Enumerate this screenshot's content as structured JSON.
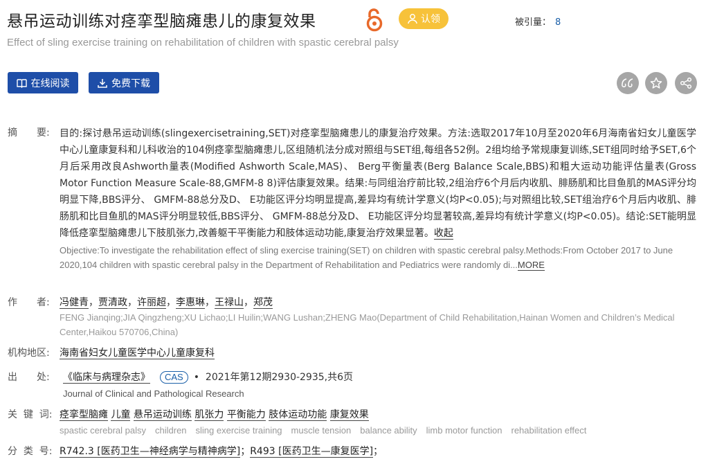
{
  "title": "悬吊运动训练对痉挛型脑瘫患儿的康复效果",
  "claim_label": "认领",
  "cite_label": "被引量：",
  "cite_count": "8",
  "title_en": "Effect of sling exercise training on rehabilitation of children with spastic cerebral palsy",
  "buttons": {
    "read": "在线阅读",
    "download": "免费下载"
  },
  "icons": {
    "quote": "quote-icon",
    "star": "star-icon",
    "share": "share-icon",
    "oa": "open-access-icon"
  },
  "colors": {
    "primary": "#1e4ea8",
    "claim": "#f7c23a",
    "oa": "#e8692a",
    "circle": "#a6a6a6"
  },
  "labels": {
    "abstract": "摘　　要:",
    "author": "作　　者:",
    "org": "机构地区:",
    "source": "出　　处:",
    "keywords": "关  键  词:",
    "classification": "分  类  号:"
  },
  "abstract_cn": "目的:探讨悬吊运动训练(slingexercisetraining,SET)对痉挛型脑瘫患儿的康复治疗效果。方法:选取2017年10月至2020年6月海南省妇女儿童医学中心儿童康复科和儿科收治的104例痉挛型脑瘫患儿,区组随机法分成对照组与SET组,每组各52例。2组均给予常规康复训练,SET组同时给予SET,6个月后采用改良Ashworth量表(Modified Ashworth Scale,MAS)、 Berg平衡量表(Berg Balance Scale,BBS)和粗大运动功能评估量表(Gross Motor Function Measure Scale-88,GMFM-8 8)评估康复效果。结果:与同组治疗前比较,2组治疗6个月后内收肌、腓肠肌和比目鱼肌的MAS评分均明显下降,BBS评分、 GMFM-88总分及D、 E功能区评分均明显提高,差异均有统计学意义(均P<0.05);与对照组比较,SET组治疗6个月后内收肌、腓肠肌和比目鱼肌的MAS评分明显较低,BBS评分、 GMFM-88总分及D、 E功能区评分均显著较高,差异均有统计学意义(均P<0.05)。结论:SET能明显降低痉挛型脑瘫患儿下肢肌张力,改善躯干平衡能力和肢体运动功能,康复治疗效果显著。",
  "collapse_label": "收起",
  "abstract_en": "Objective:To investigate the rehabilitation effect of sling exercise training(SET) on children with spastic cerebral palsy.Methods:From October 2017 to June 2020,104 children with spastic cerebral palsy in the Department of Rehabilitation and Pediatrics were randomly di...",
  "more_label": "MORE",
  "authors": [
    "冯健青",
    "贾清政",
    "许丽超",
    "李惠琳",
    "王禄山",
    "郑茂"
  ],
  "authors_en": "FENG Jianqing;JIA Qingzheng;XU Lichao;LI Huilin;WANG Lushan;ZHENG Mao(Department of Child Rehabilitation,Hainan Women and Children’s Medical Center,Haikou 570706,China)",
  "org": "海南省妇女儿童医学中心儿童康复科",
  "source": {
    "journal": "《临床与病理杂志》",
    "cas": "CAS",
    "issue": "2021年第12期2930-2935,共6页",
    "journal_en": "Journal of Clinical and Pathological Research"
  },
  "keywords_cn": [
    "痉挛型脑瘫",
    "儿童",
    "悬吊运动训练",
    "肌张力",
    "平衡能力",
    "肢体运动功能",
    "康复效果"
  ],
  "keywords_en": [
    "spastic cerebral palsy",
    "children",
    "sling exercise training",
    "muscle tension",
    "balance ability",
    "limb motor function",
    "rehabilitation effect"
  ],
  "classification": [
    {
      "code": "R742.3",
      "name": "[医药卫生—神经病学与精神病学]"
    },
    {
      "code": "R493",
      "name": "[医药卫生—康复医学]"
    }
  ]
}
